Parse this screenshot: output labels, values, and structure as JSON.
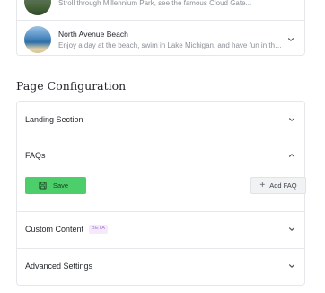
{
  "list": {
    "items": [
      {
        "title": "",
        "description": "Stroll through Millennium Park, see the famous Cloud Gate...",
        "icon": "chevron-down-icon"
      },
      {
        "title": "North Avenue Beach",
        "description": "Enjoy a day at the beach, swim in Lake Michigan, and have fun in the sun...",
        "icon": "chevron-down-icon"
      }
    ]
  },
  "page_configuration": {
    "title": "Page Configuration",
    "sections": [
      {
        "label": "Landing Section",
        "state": "collapsed",
        "icon": "chevron-down-icon"
      },
      {
        "label": "FAQs",
        "state": "expanded",
        "icon": "chevron-up-icon"
      },
      {
        "label": "Custom Content",
        "badge": "BETA",
        "state": "collapsed",
        "icon": "chevron-down-icon"
      },
      {
        "label": "Advanced Settings",
        "state": "collapsed",
        "icon": "chevron-down-icon"
      }
    ],
    "faqs": {
      "save_label": "Save",
      "add_label": "Add FAQ"
    }
  },
  "colors": {
    "save_button": "#4ccf6a",
    "beta_badge_text": "#a874d6",
    "beta_badge_bg": "#f4eafc"
  }
}
